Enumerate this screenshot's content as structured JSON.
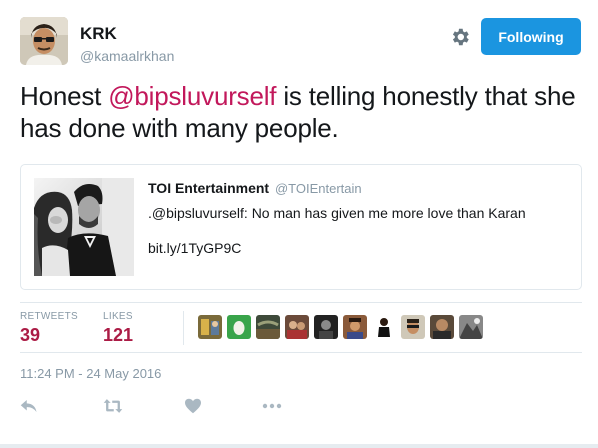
{
  "author": {
    "name": "KRK",
    "handle": "@kamaalrkhan"
  },
  "follow_button_label": "Following",
  "tweet": {
    "text_before": "Honest ",
    "mention": "@bipsluvurself",
    "text_after": " is telling honestly that she has done with many people."
  },
  "quoted_tweet": {
    "author_name": "TOI Entertainment",
    "author_handle": "@TOIEntertain",
    "text": ".@bipsluvurself: No man has given me more love than Karan",
    "link": "bit.ly/1TyGP9C"
  },
  "stats": {
    "retweets_label": "RETWEETS",
    "retweets_count": "39",
    "likes_label": "LIKES",
    "likes_count": "121"
  },
  "likers": [
    "avatar",
    "egg-avatar",
    "avatar",
    "avatar",
    "avatar",
    "avatar",
    "avatar",
    "avatar",
    "avatar",
    "avatar"
  ],
  "timestamp": "11:24 PM - 24 May 2016",
  "colors": {
    "follow_button": "#1b95e0",
    "mention": "#c2185b",
    "stat_value": "#ab1b45",
    "muted": "#8899a6",
    "border": "#e1e8ed"
  },
  "icons": [
    "settings-gear-icon",
    "reply-icon",
    "retweet-icon",
    "like-heart-icon",
    "more-dots-icon"
  ]
}
